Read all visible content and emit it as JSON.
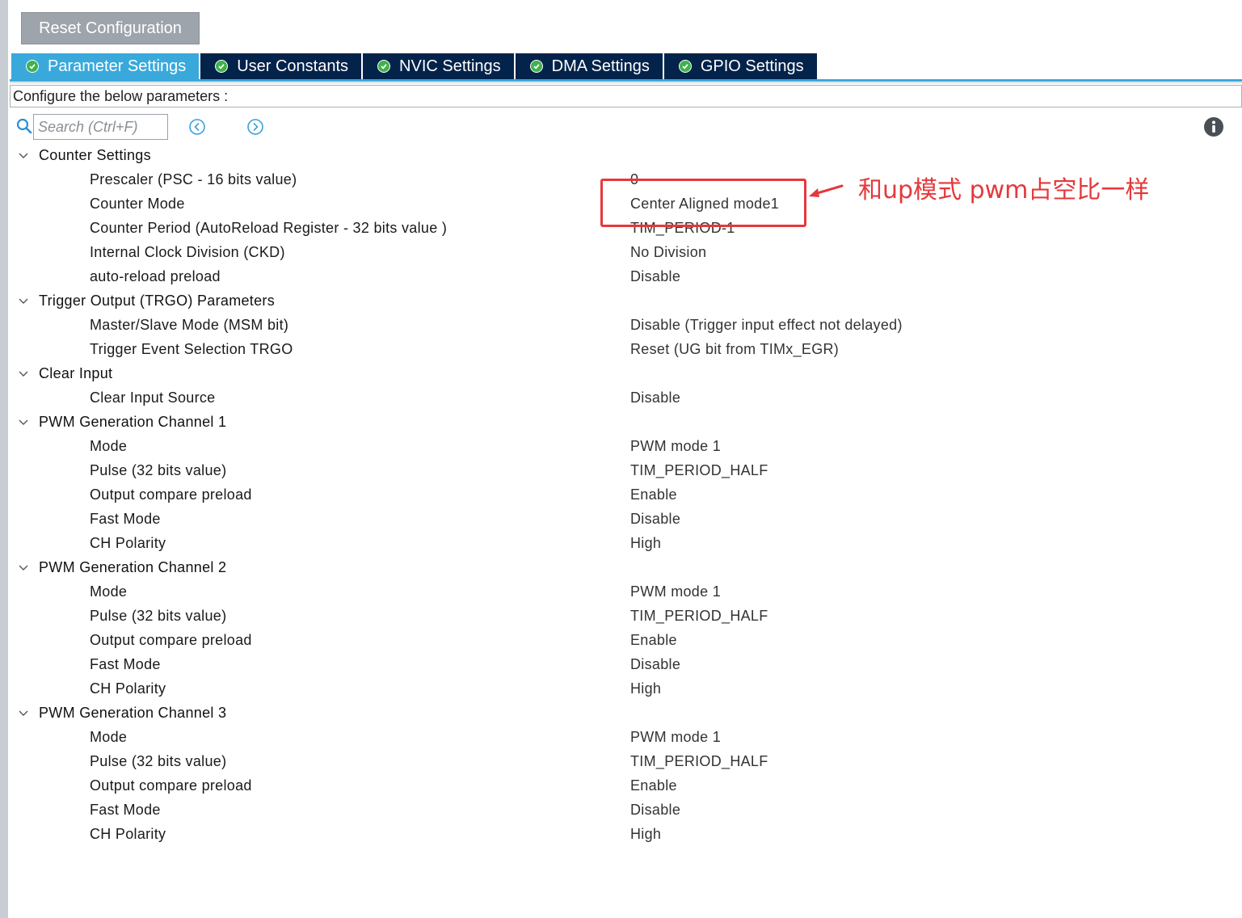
{
  "toolbar": {
    "reset_label": "Reset Configuration"
  },
  "tabs": [
    {
      "label": "Parameter Settings",
      "active": true
    },
    {
      "label": "User Constants",
      "active": false
    },
    {
      "label": "NVIC Settings",
      "active": false
    },
    {
      "label": "DMA Settings",
      "active": false
    },
    {
      "label": "GPIO Settings",
      "active": false
    }
  ],
  "config_bar": {
    "text": "Configure the below parameters :"
  },
  "search": {
    "placeholder": "Search (Ctrl+F)"
  },
  "icons": {
    "search": "search-icon",
    "prev": "chevron-left-circle-icon",
    "next": "chevron-right-circle-icon",
    "info": "info-icon",
    "tab_ok": "check-circle-icon",
    "collapse": "chevron-down-icon"
  },
  "groups": [
    {
      "title": "Counter Settings",
      "params": [
        {
          "label": "Prescaler (PSC - 16 bits value)",
          "value": "0"
        },
        {
          "label": "Counter Mode",
          "value": "Center Aligned mode1"
        },
        {
          "label": "Counter Period (AutoReload Register - 32 bits value )",
          "value": "TIM_PERIOD-1"
        },
        {
          "label": "Internal Clock Division (CKD)",
          "value": "No Division"
        },
        {
          "label": "auto-reload preload",
          "value": "Disable"
        }
      ]
    },
    {
      "title": "Trigger Output (TRGO) Parameters",
      "params": [
        {
          "label": "Master/Slave Mode (MSM bit)",
          "value": "Disable (Trigger input effect not delayed)"
        },
        {
          "label": "Trigger Event Selection TRGO",
          "value": "Reset (UG bit from TIMx_EGR)"
        }
      ]
    },
    {
      "title": "Clear Input",
      "params": [
        {
          "label": "Clear Input Source",
          "value": "Disable"
        }
      ]
    },
    {
      "title": "PWM Generation Channel 1",
      "params": [
        {
          "label": "Mode",
          "value": "PWM mode 1"
        },
        {
          "label": "Pulse (32 bits value)",
          "value": "TIM_PERIOD_HALF"
        },
        {
          "label": "Output compare preload",
          "value": "Enable"
        },
        {
          "label": "Fast Mode",
          "value": "Disable"
        },
        {
          "label": "CH Polarity",
          "value": "High"
        }
      ]
    },
    {
      "title": "PWM Generation Channel 2",
      "params": [
        {
          "label": "Mode",
          "value": "PWM mode 1"
        },
        {
          "label": "Pulse (32 bits value)",
          "value": "TIM_PERIOD_HALF"
        },
        {
          "label": "Output compare preload",
          "value": "Enable"
        },
        {
          "label": "Fast Mode",
          "value": "Disable"
        },
        {
          "label": "CH Polarity",
          "value": "High"
        }
      ]
    },
    {
      "title": "PWM Generation Channel 3",
      "params": [
        {
          "label": "Mode",
          "value": "PWM mode 1"
        },
        {
          "label": "Pulse (32 bits value)",
          "value": "TIM_PERIOD_HALF"
        },
        {
          "label": "Output compare preload",
          "value": "Enable"
        },
        {
          "label": "Fast Mode",
          "value": "Disable"
        },
        {
          "label": "CH Polarity",
          "value": "High"
        }
      ]
    }
  ],
  "annotation": {
    "text": "和up模式  pwm占空比一样",
    "color": "#e5383b"
  },
  "colors": {
    "tab_active": "#39a9dc",
    "tab_inactive": "#03234b",
    "reset_button": "#9ea4ab",
    "ok_green": "#3fb24c"
  }
}
